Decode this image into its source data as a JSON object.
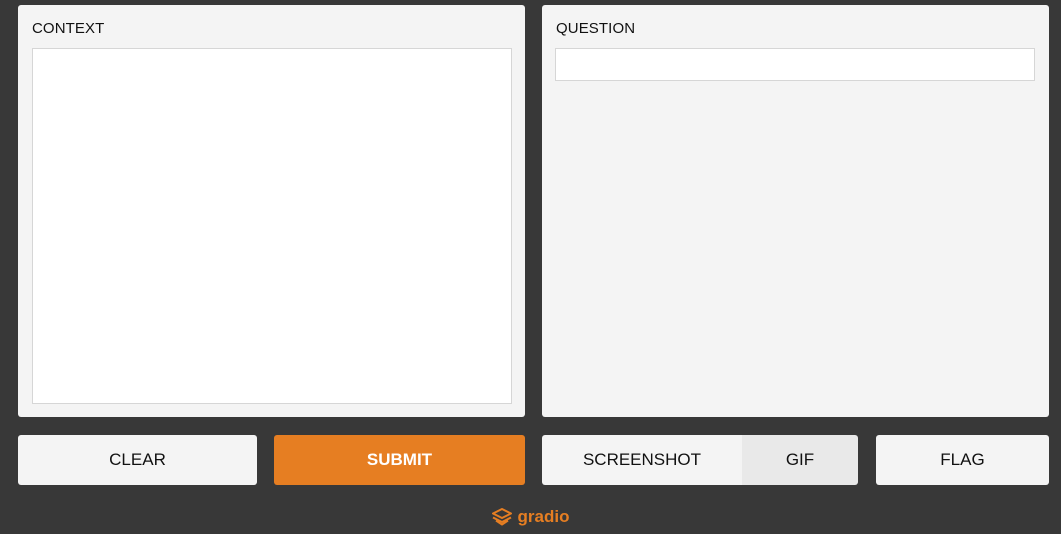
{
  "inputs": {
    "context": {
      "label": "CONTEXT",
      "value": "",
      "placeholder": ""
    },
    "question": {
      "label": "QUESTION",
      "value": "",
      "placeholder": ""
    }
  },
  "actions": {
    "clear_label": "CLEAR",
    "submit_label": "SUBMIT",
    "screenshot_label": "SCREENSHOT",
    "gif_label": "GIF",
    "flag_label": "FLAG"
  },
  "footer": {
    "brand": "gradio",
    "icon": "gradio-logo-icon"
  },
  "colors": {
    "background": "#383838",
    "panel": "#f4f4f4",
    "accent": "#e67e22"
  }
}
